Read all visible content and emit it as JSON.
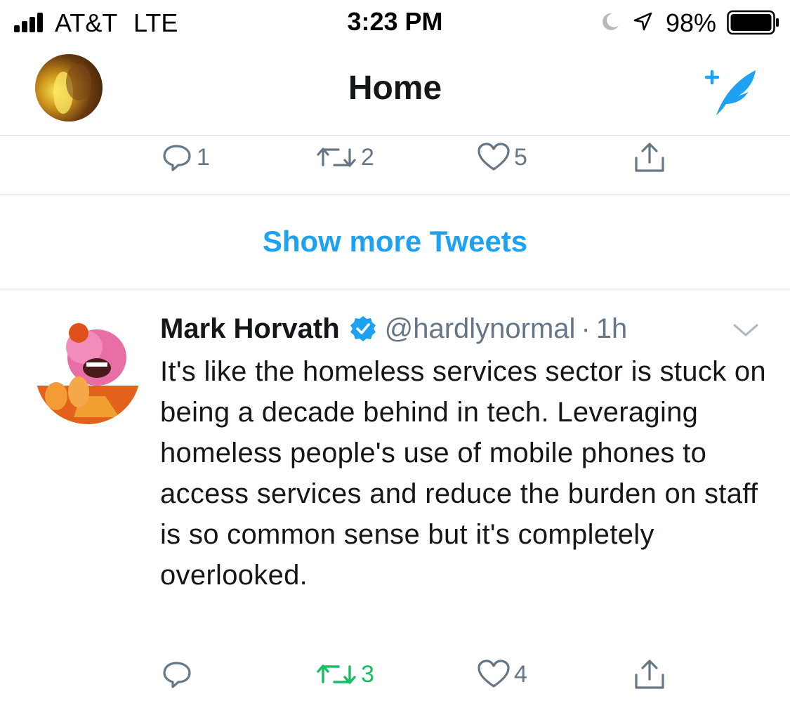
{
  "status_bar": {
    "carrier": "AT&T",
    "network": "LTE",
    "time": "3:23 PM",
    "battery": "98%",
    "icons": [
      "signal-icon",
      "moon-icon",
      "location-icon",
      "battery-icon"
    ]
  },
  "nav": {
    "title": "Home",
    "compose_icon": "compose-tweet-icon"
  },
  "previous_tweet_actions": {
    "reply_count": "1",
    "retweet_count": "2",
    "like_count": "5"
  },
  "show_more": {
    "label": "Show more Tweets"
  },
  "tweet": {
    "author_name": "Mark Horvath",
    "verified": true,
    "handle": "@hardlynormal",
    "separator": "·",
    "time": "1h",
    "text": "It's like the homeless services sector is stuck on being a decade behind in tech. Leveraging homeless people's use of mobile phones to access services and reduce the burden on staff is so common sense but it's completely overlooked.",
    "reply_count": "",
    "retweet_count": "3",
    "like_count": "4",
    "retweeted": true
  },
  "colors": {
    "accent": "#1da1f2",
    "retweet_green": "#17bf63",
    "muted": "#657786",
    "divider": "#d5d9dc"
  }
}
